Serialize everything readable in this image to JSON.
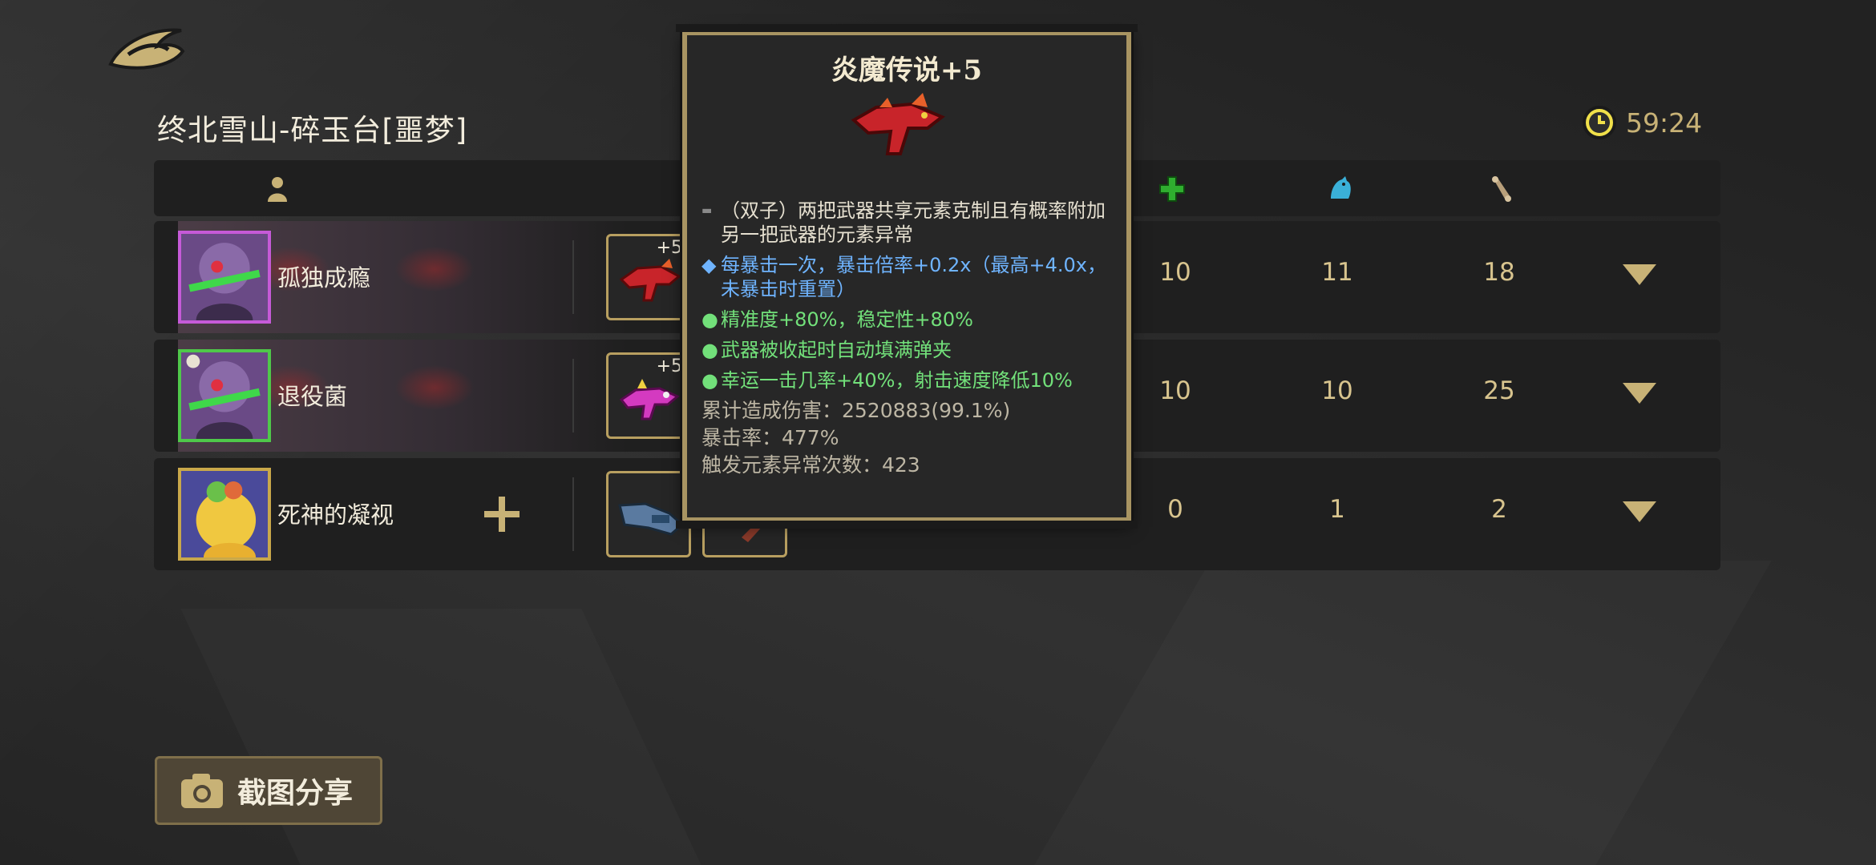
{
  "stage_title": "终北雪山-碎玉台[噩梦]",
  "timer": "59:24",
  "header_icons": [
    "player-icon",
    "heal-cross-icon",
    "pet-icon",
    "scroll-icon"
  ],
  "players": [
    {
      "name": "孤独成瘾",
      "frame_color": "#c65ad8",
      "weapon_level": "+5",
      "stats": [
        "10",
        "11",
        "18"
      ]
    },
    {
      "name": "退役菌",
      "frame_color": "#4fc84a",
      "weapon_level": "+5",
      "stats": [
        "10",
        "10",
        "25"
      ]
    },
    {
      "name": "死神的凝视",
      "frame_color": "#c9a84a",
      "weapon_level": "",
      "stats": [
        "0",
        "1",
        "2"
      ]
    }
  ],
  "share_button": "截图分享",
  "tooltip": {
    "title": "炎魔传说+5",
    "lines": [
      {
        "bullet": "▬",
        "color": "grey",
        "text": "（双子）两把武器共享元素克制且有概率附加另一把武器的元素异常"
      },
      {
        "bullet": "◆",
        "color": "blue",
        "text": "每暴击一次，暴击倍率+0.2x（最高+4.0x，未暴击时重置）"
      },
      {
        "bullet": "●",
        "color": "green",
        "text": "精准度+80%，稳定性+80%"
      },
      {
        "bullet": "●",
        "color": "green",
        "text": "武器被收起时自动填满弹夹"
      },
      {
        "bullet": "●",
        "color": "green",
        "text": "幸运一击几率+40%，射击速度降低10%"
      }
    ],
    "stats": [
      "累计造成伤害：2520883(99.1%)",
      "暴击率：477%",
      "触发元素异常次数：423"
    ]
  },
  "colors": {
    "accent_gold": "#c8b276",
    "stat_text": "#d8c48e",
    "blue_text": "#6fb4ff",
    "green_text": "#72e07a"
  }
}
